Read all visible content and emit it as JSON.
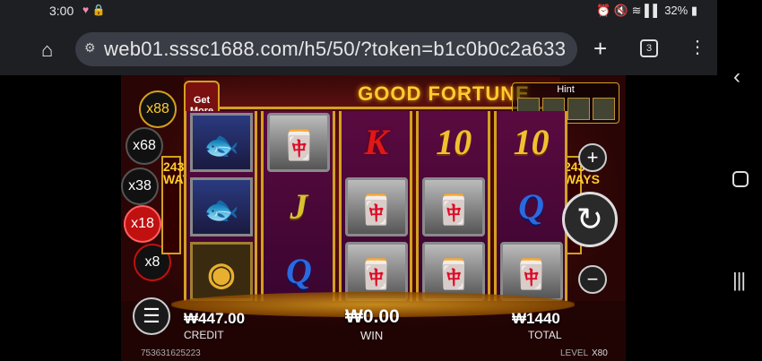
{
  "status_bar": {
    "time": "3:00",
    "battery": "32%"
  },
  "browser": {
    "url": "web01.sssc1688.com/h5/50/?token=b1c0b0c2a633",
    "tab_count": "3"
  },
  "game": {
    "title": "GOOD FORTUNE",
    "get_more": "Get More",
    "hint_label": "Hint",
    "ways": "243 WAYS",
    "multipliers": [
      "x88",
      "x68",
      "x38",
      "x18",
      "x8"
    ],
    "active_multiplier": "x18",
    "reels": [
      [
        {
          "type": "fish",
          "label": "🐟"
        },
        {
          "type": "fish",
          "label": "🐟"
        },
        {
          "type": "coin",
          "label": "◉"
        }
      ],
      [
        {
          "type": "fan",
          "label": "🀄"
        },
        {
          "type": "j",
          "label": "J"
        },
        {
          "type": "q",
          "label": "Q"
        }
      ],
      [
        {
          "type": "k",
          "label": "K"
        },
        {
          "type": "fan",
          "label": "🀄"
        },
        {
          "type": "fan",
          "label": "🀄"
        }
      ],
      [
        {
          "type": "ten",
          "label": "10"
        },
        {
          "type": "fan",
          "label": "🀄"
        },
        {
          "type": "fan",
          "label": "🀄"
        }
      ],
      [
        {
          "type": "ten",
          "label": "10"
        },
        {
          "type": "q",
          "label": "Q"
        },
        {
          "type": "fan",
          "label": "🀄"
        }
      ]
    ],
    "credit_value": "₩447.00",
    "credit_label": "CREDIT",
    "win_value": "₩0.00",
    "win_label": "WIN",
    "total_value": "₩1440",
    "total_label": "TOTAL",
    "round_id": "753631625223",
    "level_label": "LEVEL",
    "level_value": "X80"
  },
  "colors": {
    "accent_gold": "#d4a020",
    "active_mult": "#e02020"
  }
}
